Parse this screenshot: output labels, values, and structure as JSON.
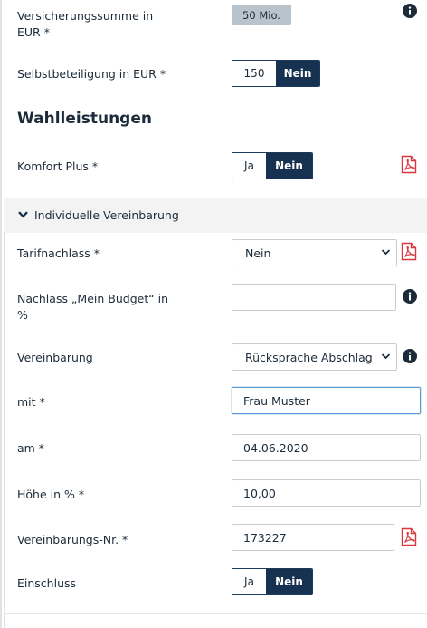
{
  "fields": {
    "sum_label": "Versicherungssumme in EUR *",
    "sum_value": "50 Mio.",
    "deductible_label": "Selbstbeteiligung in EUR *",
    "deductible_value": "150",
    "deductible_toggle": "Nein"
  },
  "optional": {
    "title": "Wahlleistungen",
    "komfort_label": "Komfort Plus *",
    "komfort_yes": "Ja",
    "komfort_no": "Nein"
  },
  "individual": {
    "title": "Individuelle Vereinbarung",
    "tariff_label": "Tarifnachlass *",
    "tariff_value": "Nein",
    "budget_label": "Nachlass „Mein Budget“ in %",
    "budget_value": "",
    "agreement_label": "Vereinbarung",
    "agreement_value": "Rücksprache Abschlag",
    "with_label": "mit *",
    "with_value": "Frau Muster",
    "on_label": "am *",
    "on_value": "04.06.2020",
    "amount_label": "Höhe in % *",
    "amount_value": "10,00",
    "number_label": "Vereinbarungs-Nr. *",
    "number_value": "173227",
    "inclusion_label": "Einschluss",
    "inclusion_yes": "Ja",
    "inclusion_no": "Nein"
  },
  "icons": {
    "info": "info-icon",
    "pdf": "pdf-icon",
    "caret": "chevron-down-icon"
  },
  "colors": {
    "accent": "#163250",
    "pdf_red": "#d9363e",
    "disabled_fill": "#b9c3cc"
  }
}
